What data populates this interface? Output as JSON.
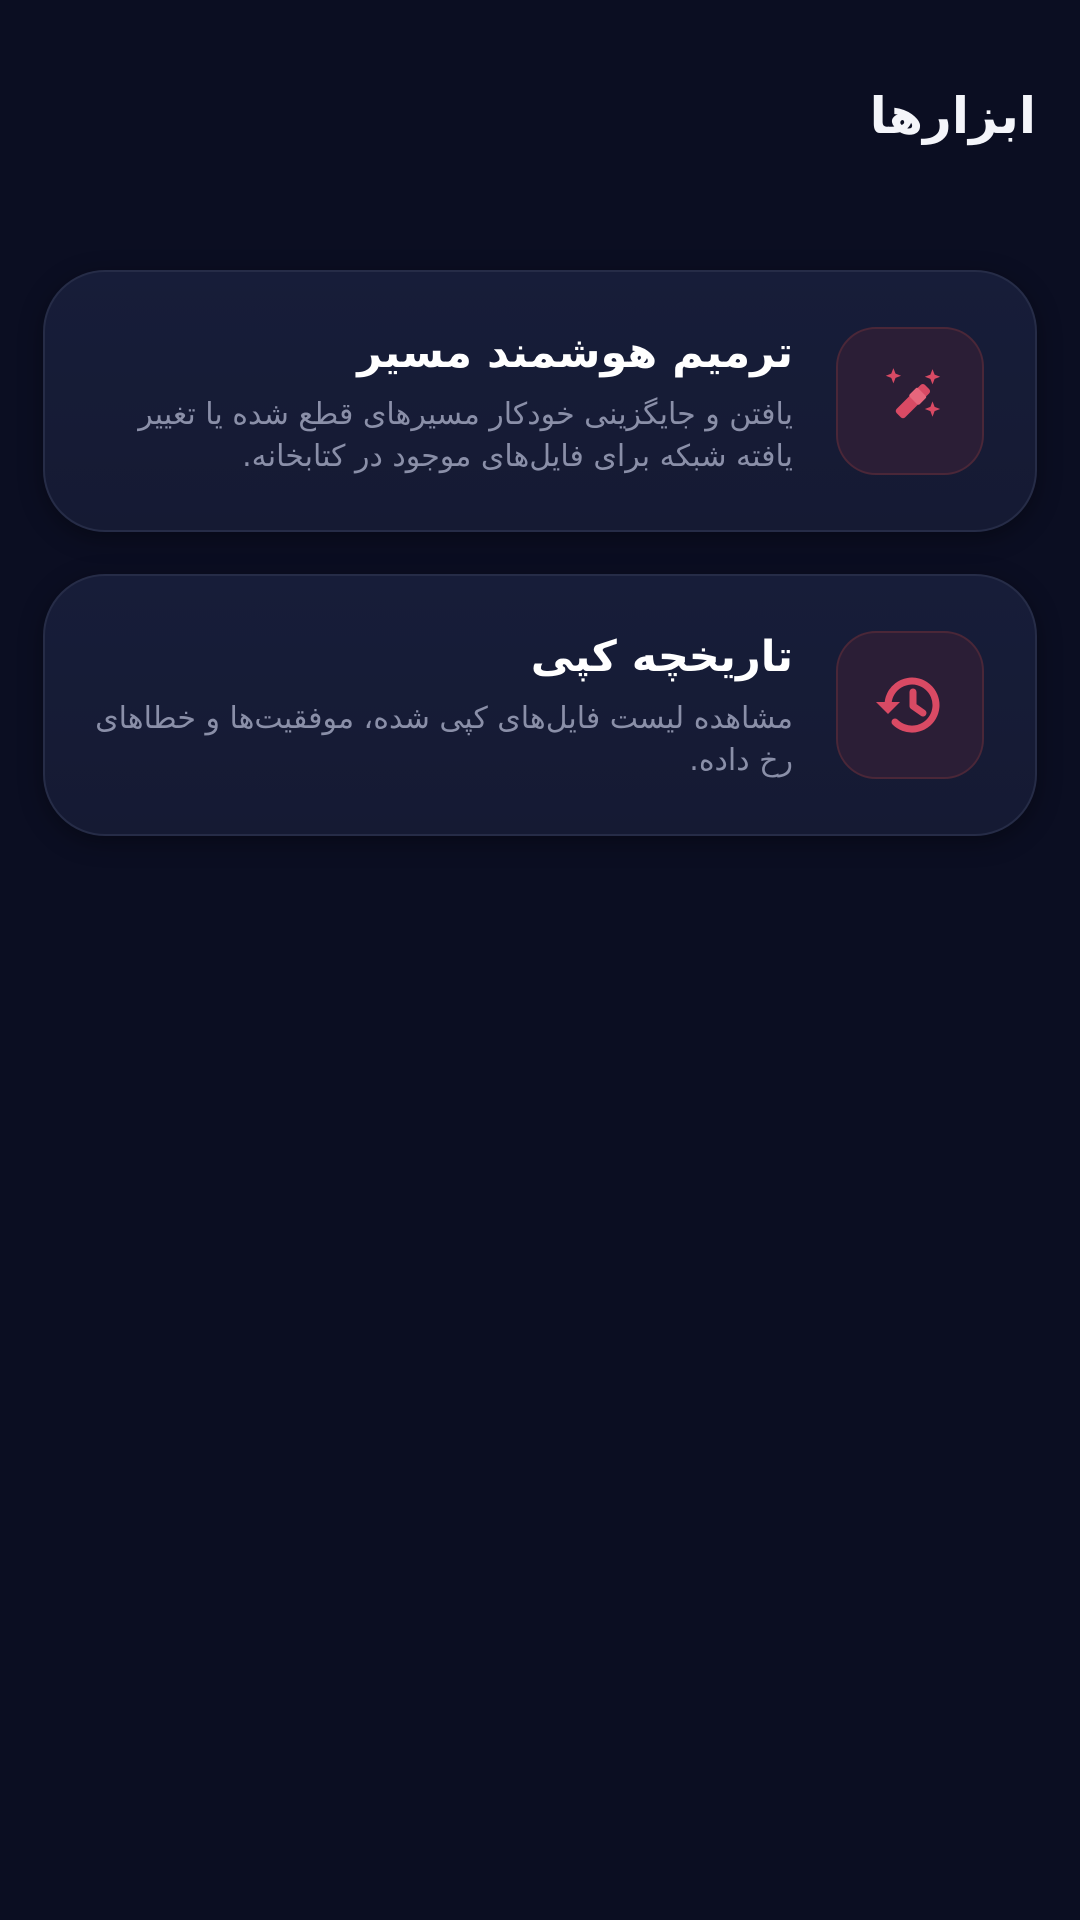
{
  "header": {
    "title": "ابزارها"
  },
  "theme": {
    "background": "#0b0e22",
    "card_background": "#171d39",
    "accent": "#d94a64",
    "icon_tile_background": "#2b1e36",
    "text_primary": "#ffffff",
    "text_secondary": "#8a8fa8"
  },
  "tools": [
    {
      "icon": "magic-wand-icon",
      "title": "ترمیم هوشمند مسیر",
      "description": "یافتن و جایگزینی خودکار مسیرهای قطع شده یا تغییر یافته شبکه برای فایل‌های موجود در کتابخانه."
    },
    {
      "icon": "history-icon",
      "title": "تاریخچه کپی",
      "description": "مشاهده لیست فایل‌های کپی شده، موفقیت‌ها و خطاهای رخ داده."
    }
  ]
}
